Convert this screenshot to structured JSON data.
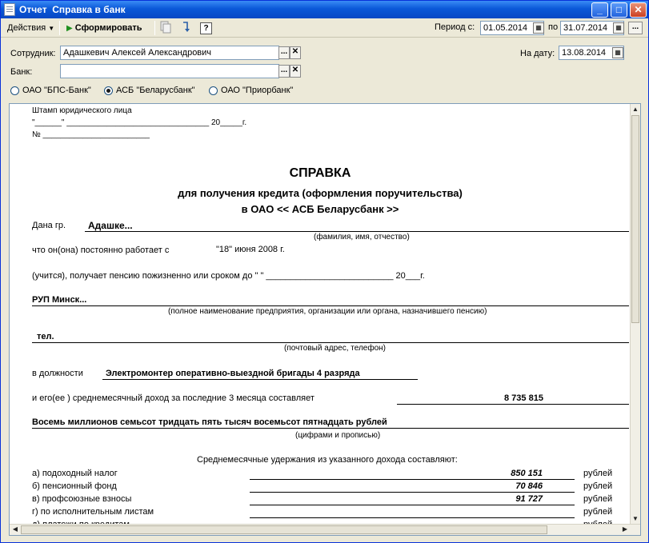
{
  "window": {
    "title": "Отчет  Справка в банк",
    "min_glyph": "_",
    "max_glyph": "□",
    "close_glyph": "✕"
  },
  "toolbar": {
    "actions_label": "Действия",
    "generate_label": "Сформировать",
    "help_glyph": "?",
    "period_from_label": "Период с:",
    "period_from": "01.05.2014",
    "period_to_label": "по",
    "period_to": "31.07.2014",
    "period_btn": "..."
  },
  "form": {
    "employee_label": "Сотрудник:",
    "employee_value": "Адашкевич Алексей Александрович",
    "bank_label": "Банк:",
    "bank_value": "",
    "date_label": "На дату:",
    "date_value": "13.08.2014",
    "choose_btn": "...",
    "clear_btn": "✕",
    "banks": [
      {
        "label": "ОАО \"БПС-Банк\"",
        "selected": false
      },
      {
        "label": "АСБ \"Беларусбанк\"",
        "selected": true
      },
      {
        "label": "ОАО \"Приорбанк\"",
        "selected": false
      }
    ]
  },
  "document": {
    "stamp": "Штамп юридического лица",
    "date_line_prefix": "\"______\" ________________________________ 20_____г.",
    "num_line": "№ ________________________",
    "title": "СПРАВКА",
    "subtitle1": "для получения кредита  (оформления поручительства)",
    "subtitle2": "в ОАО   << АСБ Беларусбанк >>",
    "given_label": "Дана гр.",
    "given_value": "Адашке...",
    "name_hint": "(фамилия, имя, отчество)",
    "works_label": "что он(она) постоянно работает с",
    "works_value": "\"18\" июня  2008 г.",
    "pension_line": "(учится), получает пенсию пожизненно или сроком до \"       \" __________________________  20___г.",
    "org_value": "РУП Минск...",
    "org_hint": "(полное наименование предприятия, организации или органа, назначившего пенсию)",
    "phone_value": "тел.",
    "address_hint": "(почтовый адрес, телефон)",
    "position_label": "в должности",
    "position_value": "Электромонтер  оперативно-выездной бригады 4 разряда",
    "income_label": "и его(ее ) среднемесячный доход за последние 3 месяца составляет",
    "income_value": "8 735 815",
    "income_words": "Восемь миллионов семьсот тридцать пять тысяч восемьсот пятнадцать рублей",
    "income_hint": "(цифрами и прописью)",
    "deductions_title": "Среднемесячные удержания из указанного дохода составляют:",
    "currency": "рублей",
    "deductions": [
      {
        "label": "а) подоходный налог",
        "value": "850 151"
      },
      {
        "label": "б) пенсионный фонд",
        "value": "70 846"
      },
      {
        "label": "в) профсоюзные взносы",
        "value": "91 727"
      },
      {
        "label": "г) по исполнительным листам",
        "value": ""
      },
      {
        "label": "д) платежи по кредитам",
        "value": ""
      }
    ]
  }
}
